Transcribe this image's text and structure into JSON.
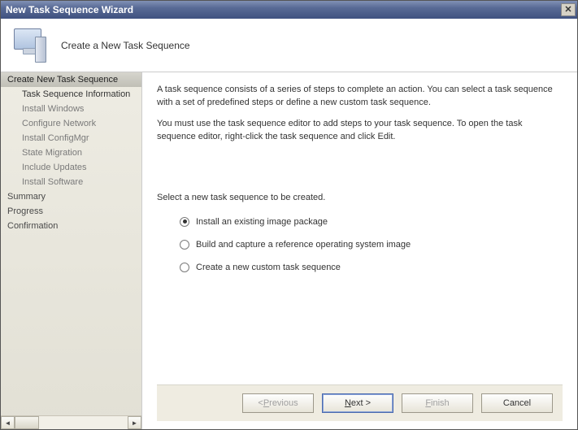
{
  "window": {
    "title": "New Task Sequence Wizard"
  },
  "header": {
    "title": "Create a New Task Sequence"
  },
  "sidebar": {
    "items": [
      {
        "label": "Create New Task Sequence",
        "type": "step",
        "selected": true
      },
      {
        "label": "Task Sequence Information",
        "type": "sub",
        "active": true
      },
      {
        "label": "Install Windows",
        "type": "sub"
      },
      {
        "label": "Configure Network",
        "type": "sub"
      },
      {
        "label": "Install ConfigMgr",
        "type": "sub"
      },
      {
        "label": "State Migration",
        "type": "sub"
      },
      {
        "label": "Include Updates",
        "type": "sub"
      },
      {
        "label": "Install Software",
        "type": "sub"
      },
      {
        "label": "Summary",
        "type": "step"
      },
      {
        "label": "Progress",
        "type": "step"
      },
      {
        "label": "Confirmation",
        "type": "step"
      }
    ]
  },
  "content": {
    "paragraph1": "A task sequence consists of a series of steps to complete an action. You can select a task sequence with a set of predefined steps or define a new custom task sequence.",
    "paragraph2": "You must use the task sequence editor to add steps to your task sequence. To open the task sequence editor, right-click the task sequence and click Edit.",
    "prompt": "Select a new task sequence to be created.",
    "options": [
      {
        "label": "Install an existing image package",
        "checked": true
      },
      {
        "label": "Build and capture a reference operating system image",
        "checked": false
      },
      {
        "label": "Create a new custom task sequence",
        "checked": false
      }
    ]
  },
  "footer": {
    "previous": "< Previous",
    "next": "Next >",
    "finish": "Finish",
    "cancel": "Cancel"
  }
}
